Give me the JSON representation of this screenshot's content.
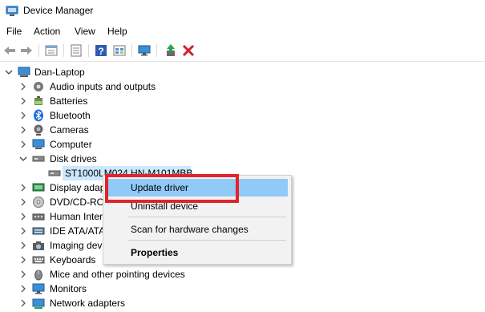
{
  "window": {
    "title": "Device Manager"
  },
  "menu": [
    "File",
    "Action",
    "View",
    "Help"
  ],
  "toolbar": {
    "icons": [
      "back-icon",
      "forward-icon",
      "properties-sheet-icon",
      "grid-icon",
      "help-icon",
      "grid-icon-2",
      "monitor-icon",
      "update-driver-icon",
      "uninstall-icon"
    ]
  },
  "tree": {
    "root": "Dan-Laptop",
    "categories": [
      {
        "label": "Audio inputs and outputs",
        "icon": "speaker-icon"
      },
      {
        "label": "Batteries",
        "icon": "battery-icon"
      },
      {
        "label": "Bluetooth",
        "icon": "bluetooth-icon"
      },
      {
        "label": "Cameras",
        "icon": "camera-icon"
      },
      {
        "label": "Computer",
        "icon": "computer-icon"
      },
      {
        "label": "Disk drives",
        "icon": "disk-drive-icon"
      },
      {
        "label": "Display adap",
        "icon": "display-adapter-icon"
      },
      {
        "label": "DVD/CD-RO",
        "icon": "dvd-icon"
      },
      {
        "label": "Human Inter",
        "icon": "hid-icon"
      },
      {
        "label": "IDE ATA/ATA",
        "icon": "ide-icon"
      },
      {
        "label": "Imaging dev",
        "icon": "imaging-icon"
      },
      {
        "label": "Keyboards",
        "icon": "keyboard-icon"
      },
      {
        "label": "Mice and other pointing devices",
        "icon": "mouse-icon"
      },
      {
        "label": "Monitors",
        "icon": "monitor-icon"
      },
      {
        "label": "Network adapters",
        "icon": "network-icon"
      }
    ],
    "disk_child": "ST1000LM024 HN-M101MBB"
  },
  "context_menu": {
    "update": "Update driver",
    "uninstall": "Uninstall device",
    "scan": "Scan for hardware changes",
    "properties": "Properties"
  },
  "colors": {
    "highlight": "#91c9f7",
    "selection": "#cce8ff",
    "annotation": "#e2232a"
  }
}
